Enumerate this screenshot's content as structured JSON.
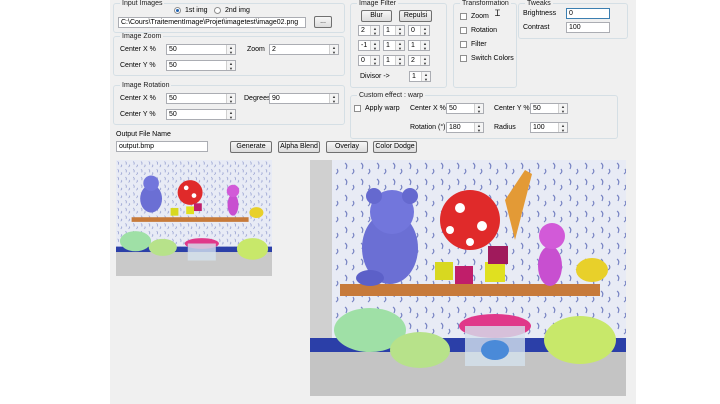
{
  "input_images": {
    "title": "Input Images",
    "radio1": "1st img",
    "radio2": "2nd img",
    "path": "C:\\Cours\\TraitementImage\\Projet\\imagetest\\image02.png",
    "browse": "..."
  },
  "image_zoom": {
    "title": "Image Zoom",
    "center_x_label": "Center X %",
    "center_x": "50",
    "zoom_label": "Zoom",
    "zoom": "2",
    "center_y_label": "Center Y %",
    "center_y": "50"
  },
  "image_rotation": {
    "title": "Image Rotation",
    "center_x_label": "Center X %",
    "center_x": "50",
    "degrees_label": "Degrees",
    "degrees": "90",
    "center_y_label": "Center Y %",
    "center_y": "50"
  },
  "image_filter": {
    "title": "Image Filter",
    "blur": "Blur",
    "repulsi": "Repulsi",
    "matrix": [
      "2",
      "1",
      "0",
      "-1",
      "1",
      "1",
      "0",
      "1",
      "2"
    ],
    "divisor_label": "Divisor ->",
    "divisor": "1"
  },
  "transformation": {
    "title": "Transformation",
    "zoom": "Zoom",
    "rotation": "Rotation",
    "filter": "Filter",
    "switch_colors": "Switch Colors"
  },
  "tweaks": {
    "title": "Tweaks",
    "brightness_label": "Brightness",
    "brightness": "0",
    "contrast_label": "Contrast",
    "contrast": "100"
  },
  "warp": {
    "title": "Custom effect : warp",
    "apply": "Apply warp",
    "center_x_label": "Center X %",
    "center_x": "50",
    "center_y_label": "Center Y %",
    "center_y": "50",
    "rotation_label": "Rotation (°)",
    "rotation": "180",
    "radius_label": "Radius",
    "radius": "100"
  },
  "output": {
    "label": "Output File Name",
    "filename": "output.bmp",
    "generate": "Generate",
    "alpha_blend": "Alpha Blend",
    "overlay": "Overlay",
    "color_dodge": "Color Dodge"
  }
}
